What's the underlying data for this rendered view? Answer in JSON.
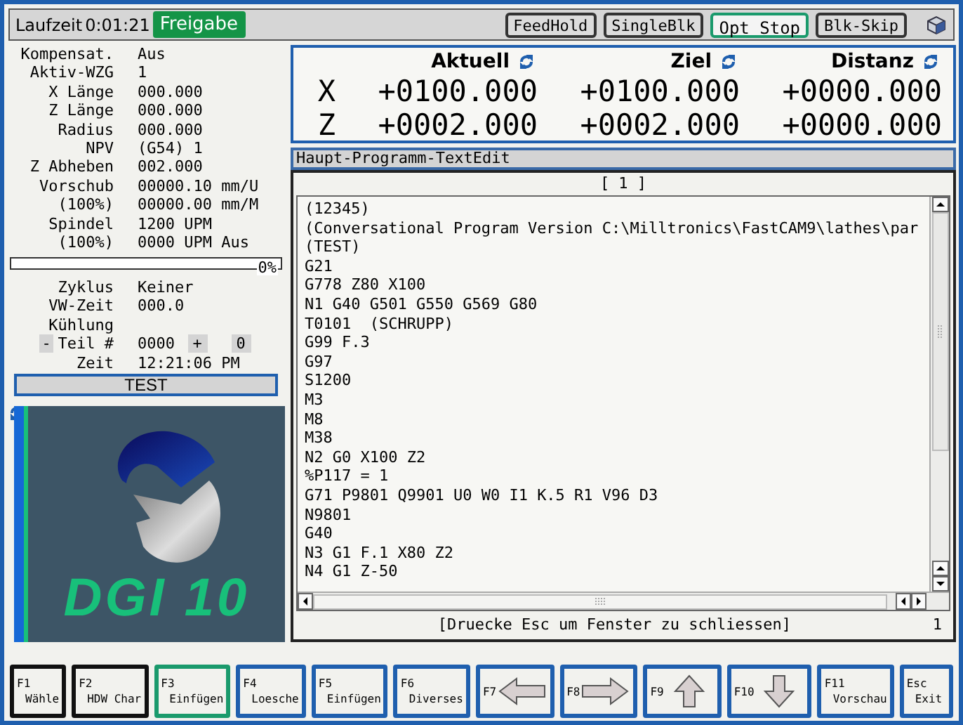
{
  "top_bar": {
    "runtime_label": "Laufzeit",
    "runtime": "0:01:21",
    "status_badge": "Freigabe",
    "toggles": [
      {
        "label": "FeedHold",
        "on": false
      },
      {
        "label": "SingleBlk",
        "on": false
      },
      {
        "label": "Opt Stop",
        "on": true
      },
      {
        "label": "Blk-Skip",
        "on": false
      }
    ]
  },
  "params": [
    {
      "label": "Kompensat.",
      "value": "Aus"
    },
    {
      "label": "Aktiv-WZG",
      "value": "1"
    },
    {
      "label": "X Länge",
      "value": "000.000"
    },
    {
      "label": "Z Länge",
      "value": "000.000"
    },
    {
      "label": "Radius",
      "value": "000.000"
    },
    {
      "label": "NPV",
      "value": "(G54) 1"
    },
    {
      "label": "Z Abheben",
      "value": "002.000"
    },
    {
      "label": "Vorschub",
      "value": "00000.10 mm/U"
    },
    {
      "label": "(100%)",
      "value": "00000.00 mm/M"
    },
    {
      "label": "Spindel",
      "value": "1200 UPM"
    },
    {
      "label": "(100%)",
      "value": "0000 UPM Aus"
    }
  ],
  "progress": {
    "level": 0,
    "reading": "0%"
  },
  "params2": [
    {
      "label": "Zyklus",
      "value": "Keiner"
    },
    {
      "label": "VW-Zeit",
      "value": "000.0"
    },
    {
      "label": "Kühlung"
    }
  ],
  "part_counter": {
    "minus": "-",
    "label": "Teil #",
    "value": "0000",
    "plus": "+",
    "total": "0"
  },
  "clock": {
    "label": "Zeit",
    "value": "12:21:06 PM"
  },
  "test_button": "TEST",
  "logo": {
    "text": "DGI 10"
  },
  "position": {
    "columns": [
      "Aktuell",
      "Ziel",
      "Distanz"
    ],
    "rows": [
      {
        "axis": "X",
        "values": [
          "+0100.000",
          "+0100.000",
          "+0000.000"
        ]
      },
      {
        "axis": "Z",
        "values": [
          "+0002.000",
          "+0002.000",
          "+0000.000"
        ]
      }
    ]
  },
  "editor": {
    "title": "Haupt-Programm-TextEdit",
    "page": "[ 1 ]",
    "lines": [
      "(12345)",
      "(Conversational Program Version C:\\Milltronics\\FastCAM9\\lathes\\par",
      "(TEST)",
      "G21",
      "G778 Z80 X100",
      "N1 G40 G501 G550 G569 G80",
      "T0101  (SCHRUPP)",
      "G99 F.3",
      "G97",
      "S1200",
      "M3",
      "M8",
      "M38",
      "N2 G0 X100 Z2",
      "%P117 = 1",
      "G71 P9801 Q9901 U0 W0 I1 K.5 R1 V96 D3",
      "N9801",
      "G40",
      "N3 G1 F.1 X80 Z2",
      "N4 G1 Z-50"
    ],
    "hint": "[Druecke Esc um Fenster zu schliessen]",
    "line_number": "1"
  },
  "soft_keys": [
    {
      "key": "F1",
      "label": "Wähle",
      "color": "#111111"
    },
    {
      "key": "F2",
      "label": "HDW Char",
      "color": "#111111"
    },
    {
      "key": "F3",
      "label": "Einfügen",
      "color": "#1a9a6c"
    },
    {
      "key": "F4",
      "label": "Loesche",
      "color": "#1f5fae"
    },
    {
      "key": "F5",
      "label": "Einfügen",
      "color": "#1f5fae"
    },
    {
      "key": "F6",
      "label": "Diverses",
      "color": "#1f5fae"
    },
    {
      "key": "F7",
      "kind": "left",
      "color": "#1f5fae"
    },
    {
      "key": "F8",
      "kind": "right",
      "color": "#1f5fae"
    },
    {
      "key": "F9",
      "kind": "up",
      "color": "#1f5fae"
    },
    {
      "key": "F10",
      "kind": "down",
      "color": "#1f5fae"
    },
    {
      "key": "F11",
      "label": "Vorschau",
      "color": "#1f5fae"
    },
    {
      "key": "Esc",
      "label": "Exit",
      "color": "#1f5fae"
    }
  ]
}
